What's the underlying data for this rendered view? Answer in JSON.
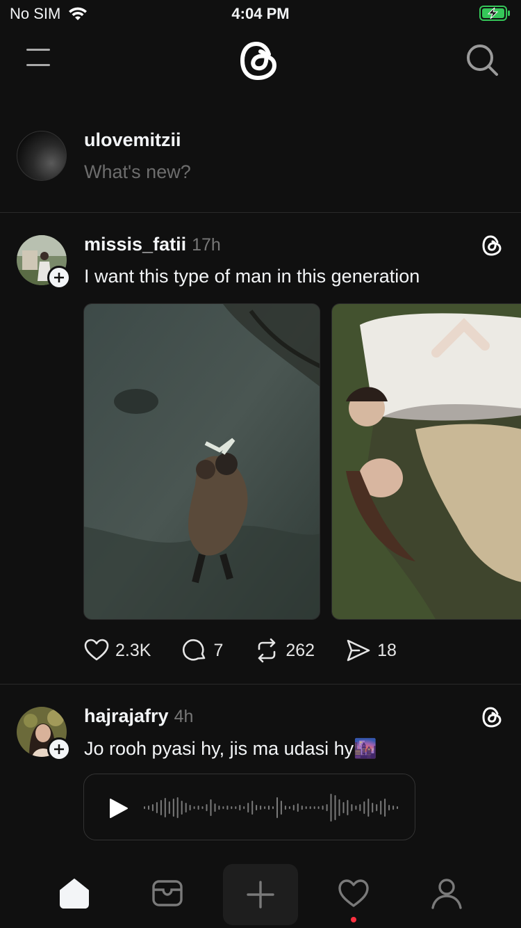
{
  "status_bar": {
    "carrier": "No SIM",
    "time": "4:04 PM",
    "icons": [
      "wifi-icon",
      "battery-charging-icon"
    ],
    "battery_color": "#35c759"
  },
  "nav": {
    "icons": [
      "menu-icon",
      "threads-logo-icon",
      "search-icon"
    ]
  },
  "composer": {
    "username": "ulovemitzii",
    "placeholder": "What's new?"
  },
  "posts": [
    {
      "username": "missis_fatii",
      "time": "17h",
      "text": "I want this type of man in this generation",
      "media": [
        "photo-couple-hug",
        "photo-couple-lying-grass"
      ],
      "stats": {
        "likes": "2.3K",
        "replies": "7",
        "reposts": "262",
        "shares": "18"
      }
    },
    {
      "username": "hajrajafry",
      "time": "4h",
      "text": "Jo rooh pyasi hy, jis ma udasi hy",
      "emoji": "🌆",
      "media": [
        "voice-note"
      ]
    }
  ],
  "tabbar": {
    "items": [
      "home-icon",
      "inbox-icon",
      "create-icon",
      "activity-icon",
      "profile-icon"
    ],
    "active": "home-icon",
    "notification_dot_color": "#ff3040"
  }
}
